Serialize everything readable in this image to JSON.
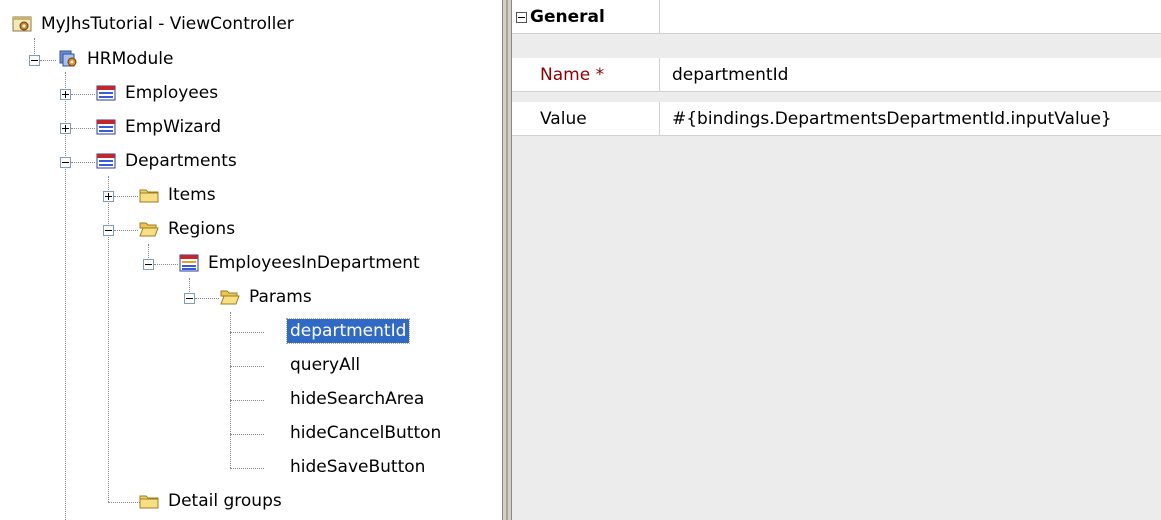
{
  "tree": {
    "root": {
      "label": "MyJhsTutorial - ViewController",
      "icon": "project-icon"
    },
    "module": {
      "label": "HRModule",
      "icon": "module-icon"
    },
    "employees": {
      "label": "Employees",
      "icon": "group-table-icon"
    },
    "empwizard": {
      "label": "EmpWizard",
      "icon": "group-table-icon"
    },
    "departments": {
      "label": "Departments",
      "icon": "group-table-icon"
    },
    "items": {
      "label": "Items",
      "icon": "folder-icon"
    },
    "regions": {
      "label": "Regions",
      "icon": "folder-open-icon"
    },
    "employees_in_department": {
      "label": "EmployeesInDepartment",
      "icon": "region-icon"
    },
    "params": {
      "label": "Params",
      "icon": "folder-open-icon"
    },
    "param_items": [
      {
        "label": "departmentId",
        "selected": true
      },
      {
        "label": "queryAll"
      },
      {
        "label": "hideSearchArea"
      },
      {
        "label": "hideCancelButton"
      },
      {
        "label": "hideSaveButton"
      }
    ],
    "detail_groups": {
      "label": "Detail groups",
      "icon": "folder-icon"
    }
  },
  "inspector": {
    "section": {
      "title": "General",
      "expanded": true
    },
    "properties": [
      {
        "name": "Name",
        "required_mark": "*",
        "value": "departmentId"
      },
      {
        "name": "Value",
        "value": "#{bindings.DepartmentsDepartmentId.inputValue}"
      }
    ]
  }
}
